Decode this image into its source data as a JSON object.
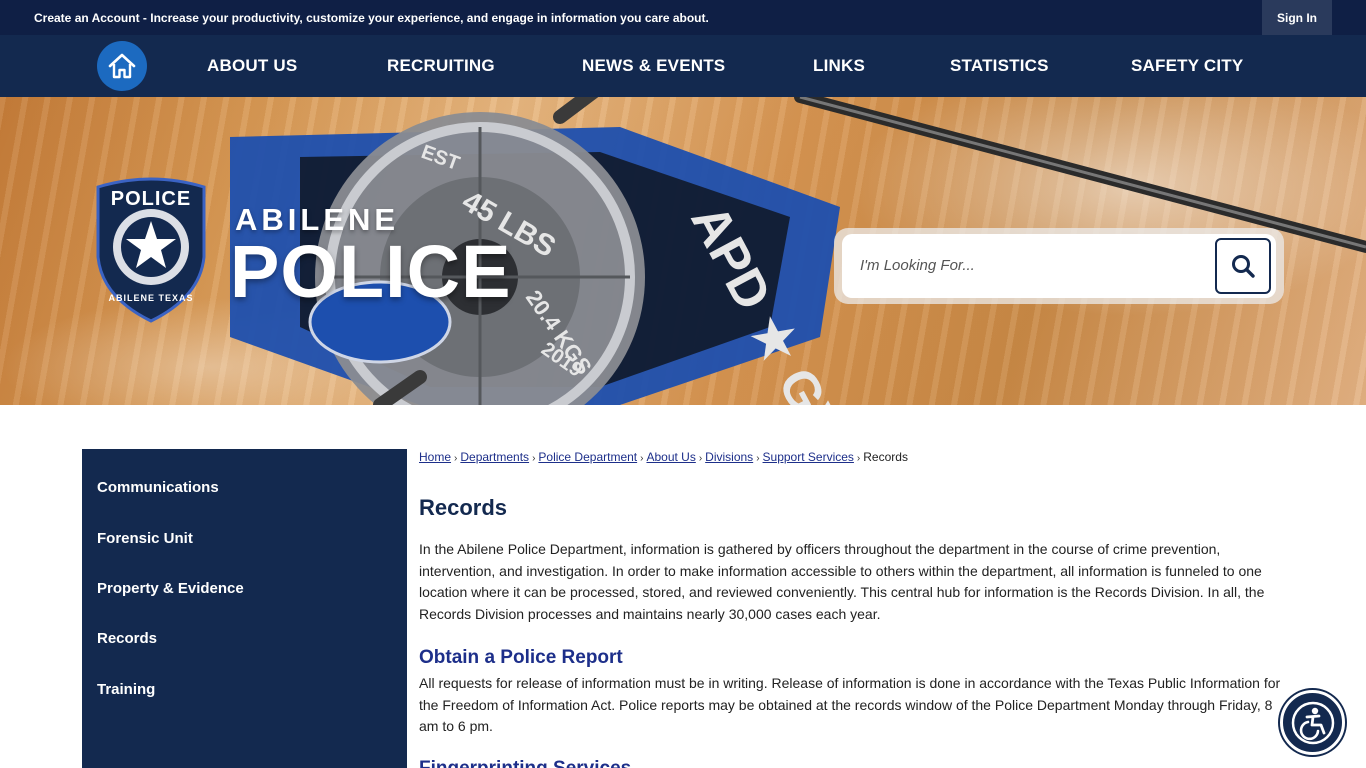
{
  "topbar": {
    "account_link": "Create an Account",
    "account_text": " - Increase your productivity, customize your experience, and engage in information you care about.",
    "sign_in": "Sign In"
  },
  "nav": {
    "home_icon": "home-icon",
    "items": [
      "ABOUT US",
      "RECRUITING",
      "NEWS & EVENTS",
      "LINKS",
      "STATISTICS",
      "SAFETY CITY"
    ]
  },
  "hero": {
    "badge_top": "POLICE",
    "badge_ring": "ABILENE TEXAS",
    "logo_line1": "ABILENE",
    "logo_line2": "POLICE",
    "gym_text": "APD ★ GYM",
    "plate_text": "45 LBS",
    "plate_text2": "20.4 KGS",
    "est_text": "EST",
    "year_text": "2019"
  },
  "search": {
    "placeholder": "I'm Looking For...",
    "button_icon": "search-icon"
  },
  "sidebar": {
    "items": [
      "Communications",
      "Forensic Unit",
      "Property & Evidence",
      "Records",
      "Training"
    ]
  },
  "breadcrumb": {
    "links": [
      "Home",
      "Departments",
      "Police Department",
      "About Us",
      "Divisions",
      "Support Services"
    ],
    "current": "Records"
  },
  "content": {
    "title": "Records",
    "intro": "In the Abilene Police Department, information is gathered by officers throughout the department in the course of crime prevention, intervention, and investigation. In order to make information accessible to others within the department, all information is funneled to one location where it can be processed, stored, and reviewed conveniently. This central hub for information is the Records Division. In all, the Records Division processes and maintains nearly 30,000 cases each year.",
    "section1_title": "Obtain a Police Report",
    "section1_text": "All requests for release of information must be in writing. Release of information is done in accordance with the Texas Public Information for the Freedom of Information Act. Police reports may be obtained at the records window of the Police Department Monday through Friday, 8 am to 6 pm.",
    "section2_title": "Fingerprinting Services"
  },
  "accessibility": {
    "icon": "accessibility-icon"
  },
  "colors": {
    "navy": "#13294f",
    "topbar": "#0f1f45",
    "home_blue": "#1c6ac0",
    "link_blue": "#1d2f8a"
  }
}
